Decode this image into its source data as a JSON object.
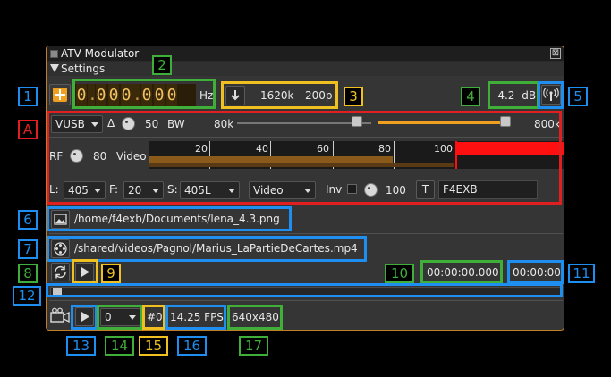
{
  "window": {
    "title": "ATV Modulator",
    "close_glyph": "⊠"
  },
  "settings": {
    "label": "Settings"
  },
  "freq": {
    "digits": [
      "0",
      ".",
      "0",
      "0",
      "0",
      ".",
      "0",
      "0",
      "0"
    ],
    "unit": "Hz"
  },
  "rate": {
    "sample_rate": "1620k",
    "samples_per_line": "200p"
  },
  "level": {
    "value": "-4.2",
    "unit": "dB"
  },
  "modulation": {
    "value": "VUSB",
    "delta_label": "Δ",
    "delta_value": "50",
    "bw_label": "BW",
    "bw_min": "80k",
    "bw_max": "800k"
  },
  "rf": {
    "label": "RF",
    "value": "80",
    "video_label": "Video",
    "scale": [
      "20",
      "40",
      "60",
      "80",
      "100"
    ],
    "video_level_fraction": 0.8
  },
  "lines": {
    "l_label": "L:",
    "l_value": "405",
    "f_label": "F:",
    "f_value": "20",
    "s_label": "S:",
    "s_value": "405L"
  },
  "source": {
    "value": "Video",
    "inv_label": "Inv",
    "uniform_value": "100",
    "text_button": "T",
    "text_value": "F4EXB"
  },
  "image": {
    "path": "/home/f4exb/Documents/lena_4.3.png"
  },
  "video": {
    "path": "/shared/videos/Pagnol/Marius_LaPartieDeCartes.mp4",
    "position": "00:00:00.000",
    "length": "00:00:00",
    "progress_fraction": 0
  },
  "camera": {
    "device": "0",
    "index": "#0",
    "fps": "14.25 FPS",
    "size": "640x480"
  },
  "annotations": {
    "n1": "1",
    "n2": "2",
    "n3": "3",
    "n4": "4",
    "n5": "5",
    "nA": "A",
    "n6": "6",
    "n7": "7",
    "n8": "8",
    "n9": "9",
    "n10": "10",
    "n11": "11",
    "n12": "12",
    "n13": "13",
    "n14": "14",
    "n15": "15",
    "n16": "16",
    "n17": "17"
  },
  "colors": {
    "blue": "#1e8ff0",
    "green": "#3faf3a",
    "yellow": "#f0c020",
    "red": "#e02020",
    "window_border": "#c07d2a",
    "accent_orange": "#f0a020"
  }
}
